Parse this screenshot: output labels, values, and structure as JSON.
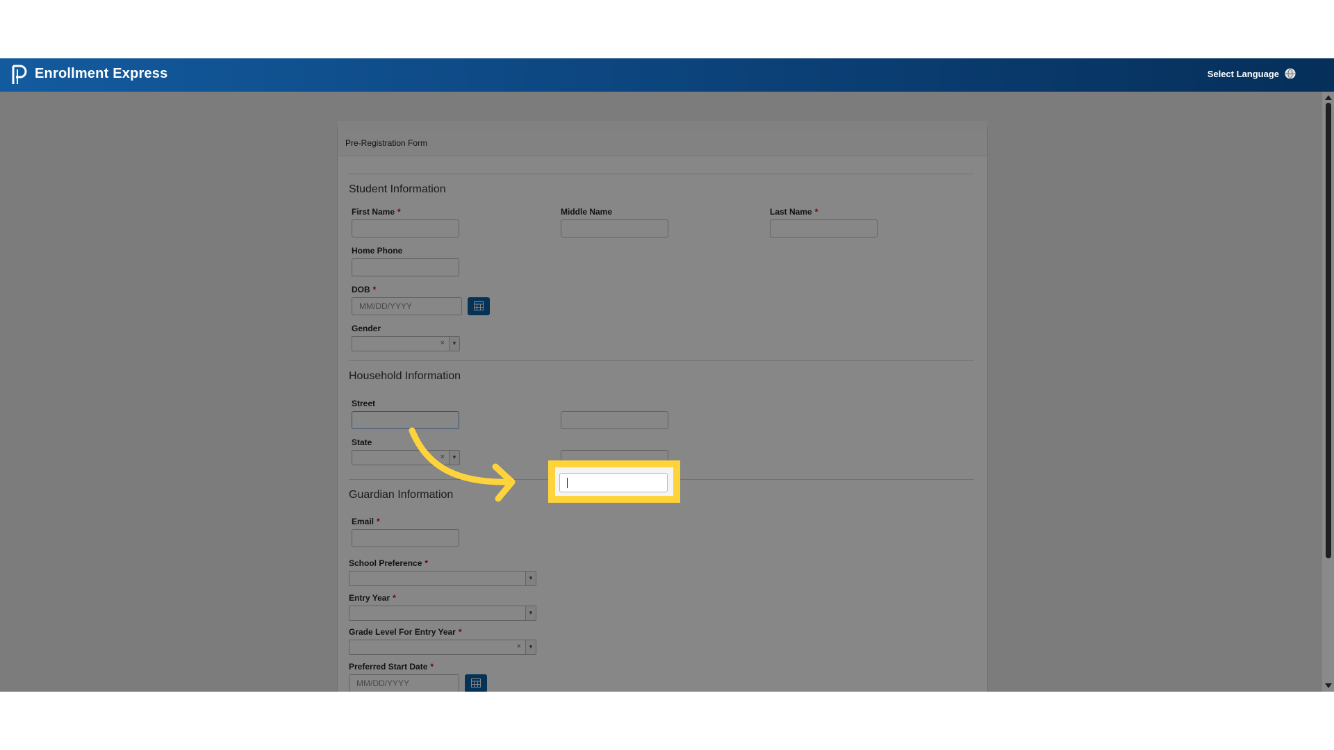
{
  "header": {
    "app_title": "Enrollment Express",
    "select_language": "Select Language",
    "logo_icon": "powerschool-logo-icon",
    "globe_icon": "globe-icon"
  },
  "form": {
    "title": "Pre-Registration Form",
    "student_section": {
      "title": "Student Information",
      "first_name_label": "First Name",
      "middle_name_label": "Middle Name",
      "last_name_label": "Last Name",
      "home_phone_label": "Home Phone",
      "dob_label": "DOB",
      "dob_placeholder": "MM/DD/YYYY",
      "gender_label": "Gender",
      "gender_value": ""
    },
    "household_section": {
      "title": "Household Information",
      "street_label": "Street",
      "state_label": "State",
      "state_value": "",
      "city_value": "",
      "zip_value": ""
    },
    "guardian_section": {
      "title": "Guardian Information",
      "email_label": "Email",
      "school_preference_label": "School Preference",
      "entry_year_label": "Entry Year",
      "grade_level_label": "Grade Level For Entry Year",
      "preferred_start_label": "Preferred Start Date",
      "preferred_start_placeholder": "MM/DD/YYYY"
    },
    "required_marker": "*",
    "clear_glyph": "×",
    "dropdown_glyph": "▼"
  },
  "overlay": {
    "highlight_color": "#ffd43b",
    "dim_color": "#000000"
  }
}
